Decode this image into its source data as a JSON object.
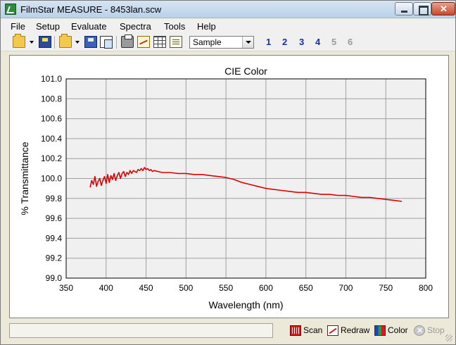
{
  "window": {
    "title": "FilmStar MEASURE - 8453lan.scw",
    "app_icon": "filmstar-icon"
  },
  "menu": [
    {
      "label": "File",
      "mnemonic": "F"
    },
    {
      "label": "Setup",
      "mnemonic": "S"
    },
    {
      "label": "Evaluate",
      "mnemonic": "v"
    },
    {
      "label": "Spectra",
      "mnemonic": "p"
    },
    {
      "label": "Tools",
      "mnemonic": "T"
    },
    {
      "label": "Help",
      "mnemonic": "H"
    }
  ],
  "toolbar": {
    "icons": [
      "open-folder-icon",
      "save-disk-icon",
      "open-folder-icon",
      "save-disk-icon",
      "copy-icon",
      "print-icon",
      "chart-icon",
      "table-icon",
      "notes-icon"
    ],
    "sample_select": {
      "value": "Sample"
    },
    "number_buttons": [
      {
        "label": "1",
        "enabled": true
      },
      {
        "label": "2",
        "enabled": true
      },
      {
        "label": "3",
        "enabled": true
      },
      {
        "label": "4",
        "enabled": true
      },
      {
        "label": "5",
        "enabled": false
      },
      {
        "label": "6",
        "enabled": false
      }
    ]
  },
  "chart_data": {
    "type": "line",
    "title": "CIE Color",
    "xlabel": "Wavelength (nm)",
    "ylabel": "% Transmittance",
    "xlim": [
      350,
      800
    ],
    "ylim": [
      99.0,
      101.0
    ],
    "xticks": [
      350,
      400,
      450,
      500,
      550,
      600,
      650,
      700,
      750,
      800
    ],
    "xtick_labels": [
      "350",
      "400",
      "450",
      "500",
      "550",
      "600",
      "650",
      "700",
      "750",
      "800"
    ],
    "yticks": [
      99.0,
      99.2,
      99.4,
      99.6,
      99.8,
      100.0,
      100.2,
      100.4,
      100.6,
      100.8,
      101.0
    ],
    "ytick_labels": [
      "99.0",
      "99.2",
      "99.4",
      "99.6",
      "99.8",
      "100.0",
      "100.2",
      "100.4",
      "100.6",
      "100.8",
      "101.0"
    ],
    "grid": true,
    "series": [
      {
        "color": "#e00000",
        "x": [
          380,
          382,
          384,
          386,
          388,
          390,
          392,
          394,
          396,
          398,
          400,
          402,
          404,
          406,
          408,
          410,
          412,
          414,
          416,
          418,
          420,
          422,
          424,
          426,
          428,
          430,
          432,
          434,
          436,
          438,
          440,
          442,
          444,
          446,
          448,
          450,
          452,
          454,
          456,
          458,
          460,
          470,
          480,
          490,
          500,
          510,
          520,
          530,
          540,
          550,
          560,
          570,
          580,
          590,
          600,
          610,
          620,
          630,
          640,
          650,
          660,
          670,
          680,
          690,
          700,
          710,
          720,
          730,
          740,
          750,
          760,
          770
        ],
        "y": [
          99.91,
          99.98,
          99.94,
          100.02,
          99.92,
          99.97,
          100.0,
          99.93,
          99.98,
          100.02,
          99.95,
          100.04,
          99.96,
          100.03,
          99.99,
          100.05,
          99.98,
          100.03,
          100.06,
          100.0,
          100.05,
          100.07,
          100.02,
          100.06,
          100.04,
          100.08,
          100.05,
          100.08,
          100.07,
          100.06,
          100.09,
          100.08,
          100.1,
          100.08,
          100.11,
          100.09,
          100.1,
          100.08,
          100.09,
          100.07,
          100.08,
          100.06,
          100.06,
          100.05,
          100.05,
          100.04,
          100.04,
          100.03,
          100.02,
          100.01,
          99.99,
          99.96,
          99.94,
          99.92,
          99.9,
          99.89,
          99.88,
          99.87,
          99.86,
          99.86,
          99.85,
          99.84,
          99.84,
          99.83,
          99.83,
          99.82,
          99.81,
          99.81,
          99.8,
          99.79,
          99.78,
          99.77
        ]
      }
    ]
  },
  "status": {
    "text": "",
    "buttons": [
      {
        "label": "Scan",
        "mnemonic": "S",
        "icon": "scan-icon",
        "enabled": true
      },
      {
        "label": "Redraw",
        "mnemonic": "w",
        "icon": "redraw-icon",
        "enabled": true
      },
      {
        "label": "Color",
        "mnemonic": "C",
        "icon": "color-icon",
        "enabled": true
      },
      {
        "label": "Stop",
        "mnemonic": "t",
        "icon": "stop-icon",
        "enabled": false
      }
    ]
  }
}
